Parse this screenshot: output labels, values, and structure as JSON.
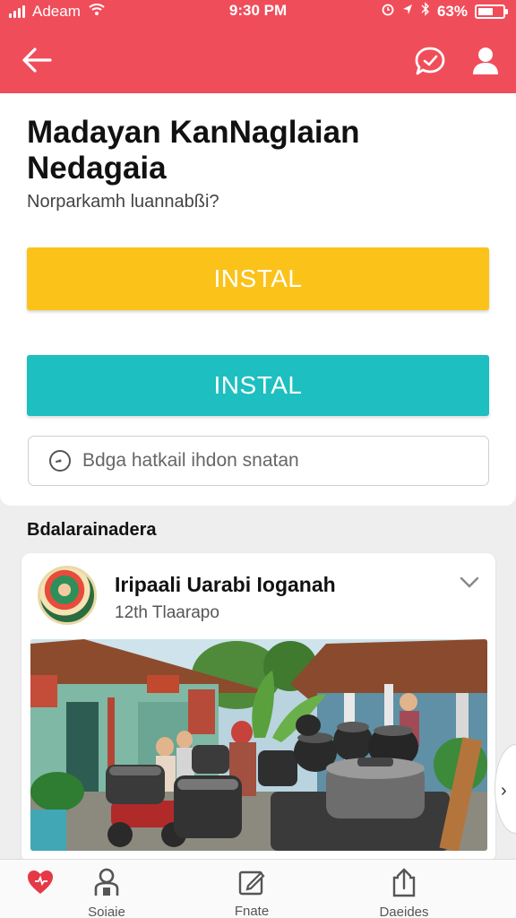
{
  "status_bar": {
    "carrier": "Adeam",
    "time": "9:30 PM",
    "battery_percent": "63%",
    "battery_level": 0.63
  },
  "header": {
    "back_icon": "arrow-left-icon",
    "chat_icon": "chat-bubble-icon",
    "profile_icon": "user-icon",
    "color": "#f04d5a"
  },
  "app_info": {
    "title": "Madayan KanNaglaian Nedagaia",
    "subtitle": "Norparkamh luannabßi?",
    "primary_button": "INSTAL",
    "secondary_button": "INSTAL",
    "search_placeholder": "Bdga hatkail ihdon snatan",
    "primary_color": "#fbc21a",
    "secondary_color": "#1dbfc0"
  },
  "section": {
    "label": "Bdalarainadera"
  },
  "post": {
    "title": "Iripaali Uarabi Ioganah",
    "meta": "12th Tlaarapo"
  },
  "tabs": [
    {
      "label": "",
      "icon": "heart-icon"
    },
    {
      "label": "Soiaie",
      "icon": "user-lock-icon"
    },
    {
      "label": "Fnate",
      "icon": "edit-icon"
    },
    {
      "label": "Daeides",
      "icon": "share-icon"
    }
  ]
}
